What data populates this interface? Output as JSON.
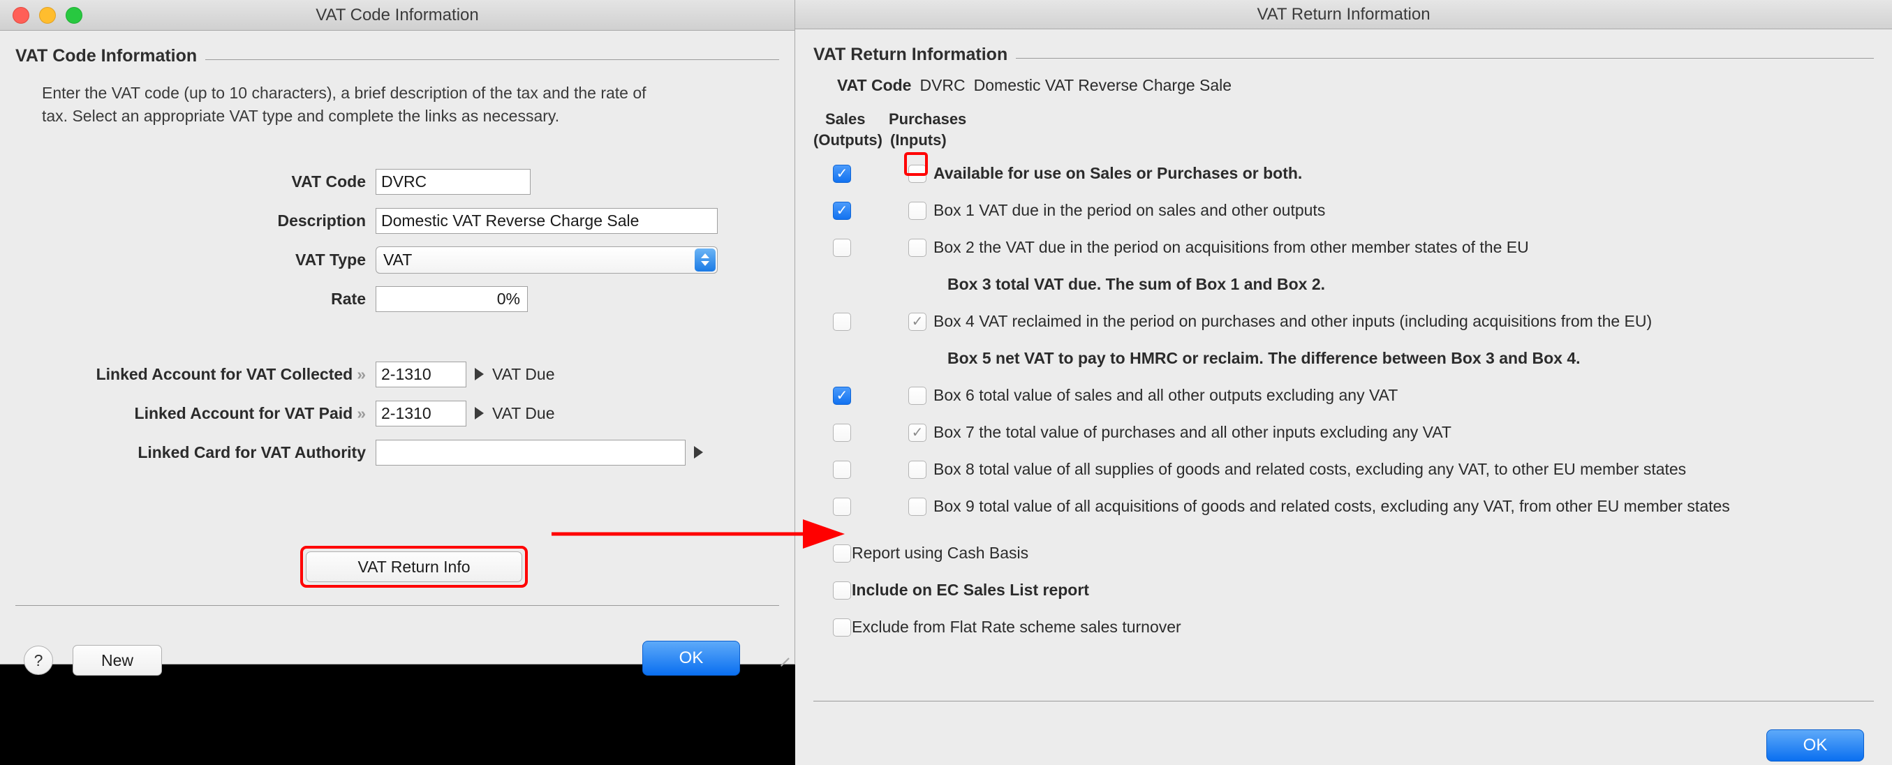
{
  "left_window": {
    "title": "VAT Code Information",
    "traffic_lights": [
      "close",
      "minimize",
      "zoom"
    ],
    "group_title": "VAT Code Information",
    "intro": "Enter the VAT code (up to 10 characters), a brief description of the tax and the rate of tax.  Select an appropriate VAT type and complete the links as necessary.",
    "fields": {
      "vat_code_label": "VAT Code",
      "vat_code_value": "DVRC",
      "description_label": "Description",
      "description_value": "Domestic VAT Reverse Charge Sale",
      "vat_type_label": "VAT Type",
      "vat_type_value": "VAT",
      "rate_label": "Rate",
      "rate_value": "0%",
      "linked_collected_label": "Linked Account for VAT Collected",
      "linked_collected_value": "2-1310",
      "linked_collected_name": "VAT Due",
      "linked_paid_label": "Linked Account for VAT Paid",
      "linked_paid_value": "2-1310",
      "linked_paid_name": "VAT Due",
      "linked_card_label": "Linked Card for VAT Authority",
      "linked_card_value": ""
    },
    "buttons": {
      "vat_return_info": "VAT Return Info",
      "help": "?",
      "new": "New",
      "ok": "OK"
    }
  },
  "right_window": {
    "title": "VAT Return Information",
    "group_title": "VAT Return Information",
    "vat_code_label": "VAT Code",
    "vat_code_value": "DVRC",
    "vat_code_description": "Domestic VAT Reverse Charge Sale",
    "columns": {
      "sales_line1": "Sales",
      "sales_line2": "(Outputs)",
      "purchases_line1": "Purchases",
      "purchases_line2": "(Inputs)"
    },
    "rows": [
      {
        "kind": "dual",
        "sales": true,
        "purchases": false,
        "purchases_dim": false,
        "bold": true,
        "highlight_purchases": true,
        "text": "Available for use on Sales or Purchases or both."
      },
      {
        "kind": "dual",
        "sales": true,
        "purchases": false,
        "purchases_dim": false,
        "bold": false,
        "highlight_purchases": false,
        "text": "Box 1 VAT due in the period on sales and other outputs"
      },
      {
        "kind": "dual",
        "sales": false,
        "purchases": false,
        "purchases_dim": false,
        "bold": false,
        "highlight_purchases": false,
        "text": "Box 2 the VAT due in the period on acquisitions from other member states of the EU"
      },
      {
        "kind": "note",
        "text": "Box 3 total VAT due. The sum of Box 1 and Box 2."
      },
      {
        "kind": "dual",
        "sales": false,
        "purchases": true,
        "purchases_dim": true,
        "bold": false,
        "highlight_purchases": false,
        "text": "Box 4 VAT reclaimed in the period on purchases and other inputs (including acquisitions from the EU)"
      },
      {
        "kind": "note",
        "text": "Box 5 net VAT to pay to HMRC or reclaim. The difference between Box 3 and Box 4."
      },
      {
        "kind": "dual",
        "sales": true,
        "purchases": false,
        "purchases_dim": false,
        "bold": false,
        "highlight_purchases": false,
        "text": "Box 6 total value of sales and all other outputs excluding any VAT"
      },
      {
        "kind": "dual",
        "sales": false,
        "purchases": true,
        "purchases_dim": true,
        "bold": false,
        "highlight_purchases": false,
        "text": "Box 7 the total value of purchases and all other inputs excluding any VAT"
      },
      {
        "kind": "dual",
        "sales": false,
        "purchases": false,
        "purchases_dim": false,
        "bold": false,
        "highlight_purchases": false,
        "text": "Box 8 total value of all supplies of goods and related costs, excluding any VAT, to other EU member states"
      },
      {
        "kind": "dual",
        "sales": false,
        "purchases": false,
        "purchases_dim": false,
        "bold": false,
        "highlight_purchases": false,
        "text": "Box 9 total value of all acquisitions of goods and related costs, excluding any VAT, from other EU member states"
      }
    ],
    "option_rows": [
      {
        "checked": false,
        "bold": false,
        "text": "Report using Cash Basis"
      },
      {
        "checked": false,
        "bold": true,
        "text": "Include on EC Sales List report"
      },
      {
        "checked": false,
        "bold": false,
        "text": "Exclude from Flat Rate scheme sales turnover"
      }
    ],
    "buttons": {
      "ok": "OK"
    }
  },
  "annotation": {
    "highlight_color": "#ff0000",
    "arrow_label": "points from VAT Return Info button to the Available-for-use purchases checkbox"
  },
  "icons": {
    "chevron_double_right": "»",
    "triangle_right": "▶",
    "check": "✓",
    "stepper_up": "▲",
    "stepper_down": "▼"
  }
}
